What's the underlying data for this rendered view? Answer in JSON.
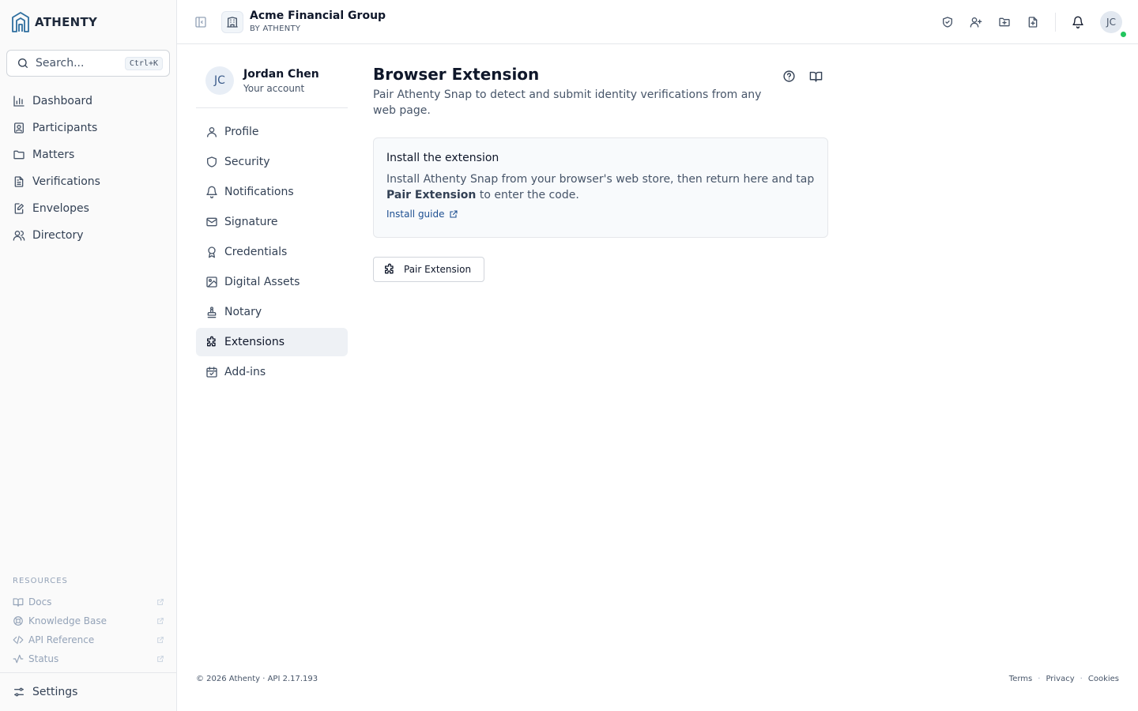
{
  "brand": {
    "name": "ATHENTY",
    "logo_icon": "athenty-logo-icon"
  },
  "search": {
    "placeholder": "Search...",
    "shortcut": "Ctrl+K"
  },
  "sidebar": {
    "items": [
      {
        "label": "Dashboard",
        "icon": "bar-chart-icon"
      },
      {
        "label": "Participants",
        "icon": "contact-card-icon"
      },
      {
        "label": "Matters",
        "icon": "folder-icon"
      },
      {
        "label": "Verifications",
        "icon": "document-icon"
      },
      {
        "label": "Envelopes",
        "icon": "file-edit-icon"
      },
      {
        "label": "Directory",
        "icon": "users-icon"
      }
    ],
    "resources_heading": "RESOURCES",
    "resources": [
      {
        "label": "Docs",
        "icon": "book-icon"
      },
      {
        "label": "Knowledge Base",
        "icon": "life-buoy-icon"
      },
      {
        "label": "API Reference",
        "icon": "code-icon"
      },
      {
        "label": "Status",
        "icon": "activity-icon"
      }
    ],
    "settings_label": "Settings"
  },
  "header": {
    "org_name": "Acme Financial Group",
    "org_sub": "BY ATHENTY",
    "avatar_initials": "JC",
    "actions": [
      "shield-check-icon",
      "user-plus-icon",
      "folder-plus-icon",
      "file-plus-icon",
      "bell-icon"
    ]
  },
  "account": {
    "initials": "JC",
    "name": "Jordan Chen",
    "subtitle": "Your account"
  },
  "subnav": {
    "items": [
      {
        "label": "Profile",
        "icon": "user-icon"
      },
      {
        "label": "Security",
        "icon": "shield-icon"
      },
      {
        "label": "Notifications",
        "icon": "bell-icon"
      },
      {
        "label": "Signature",
        "icon": "mail-icon"
      },
      {
        "label": "Credentials",
        "icon": "award-icon"
      },
      {
        "label": "Digital Assets",
        "icon": "image-icon"
      },
      {
        "label": "Notary",
        "icon": "stamp-icon"
      },
      {
        "label": "Extensions",
        "icon": "puzzle-icon",
        "active": true
      },
      {
        "label": "Add-ins",
        "icon": "calendar-check-icon"
      }
    ]
  },
  "main": {
    "title": "Browser Extension",
    "description": "Pair Athenty Snap to detect and submit identity verifications from any web page.",
    "card": {
      "title": "Install the extension",
      "text_before": "Install Athenty Snap from your browser's web store, then return here and tap ",
      "text_bold": "Pair Extension",
      "text_after": " to enter the code.",
      "link_label": "Install guide"
    },
    "pair_button": "Pair Extension"
  },
  "footer": {
    "copyright": "© 2026 Athenty · API 2.17.193",
    "links": [
      "Terms",
      "Privacy",
      "Cookies"
    ],
    "separator": "·"
  },
  "colors": {
    "accent": "#1d4f91",
    "online": "#22c55e",
    "active_bg": "#eef1f5"
  }
}
